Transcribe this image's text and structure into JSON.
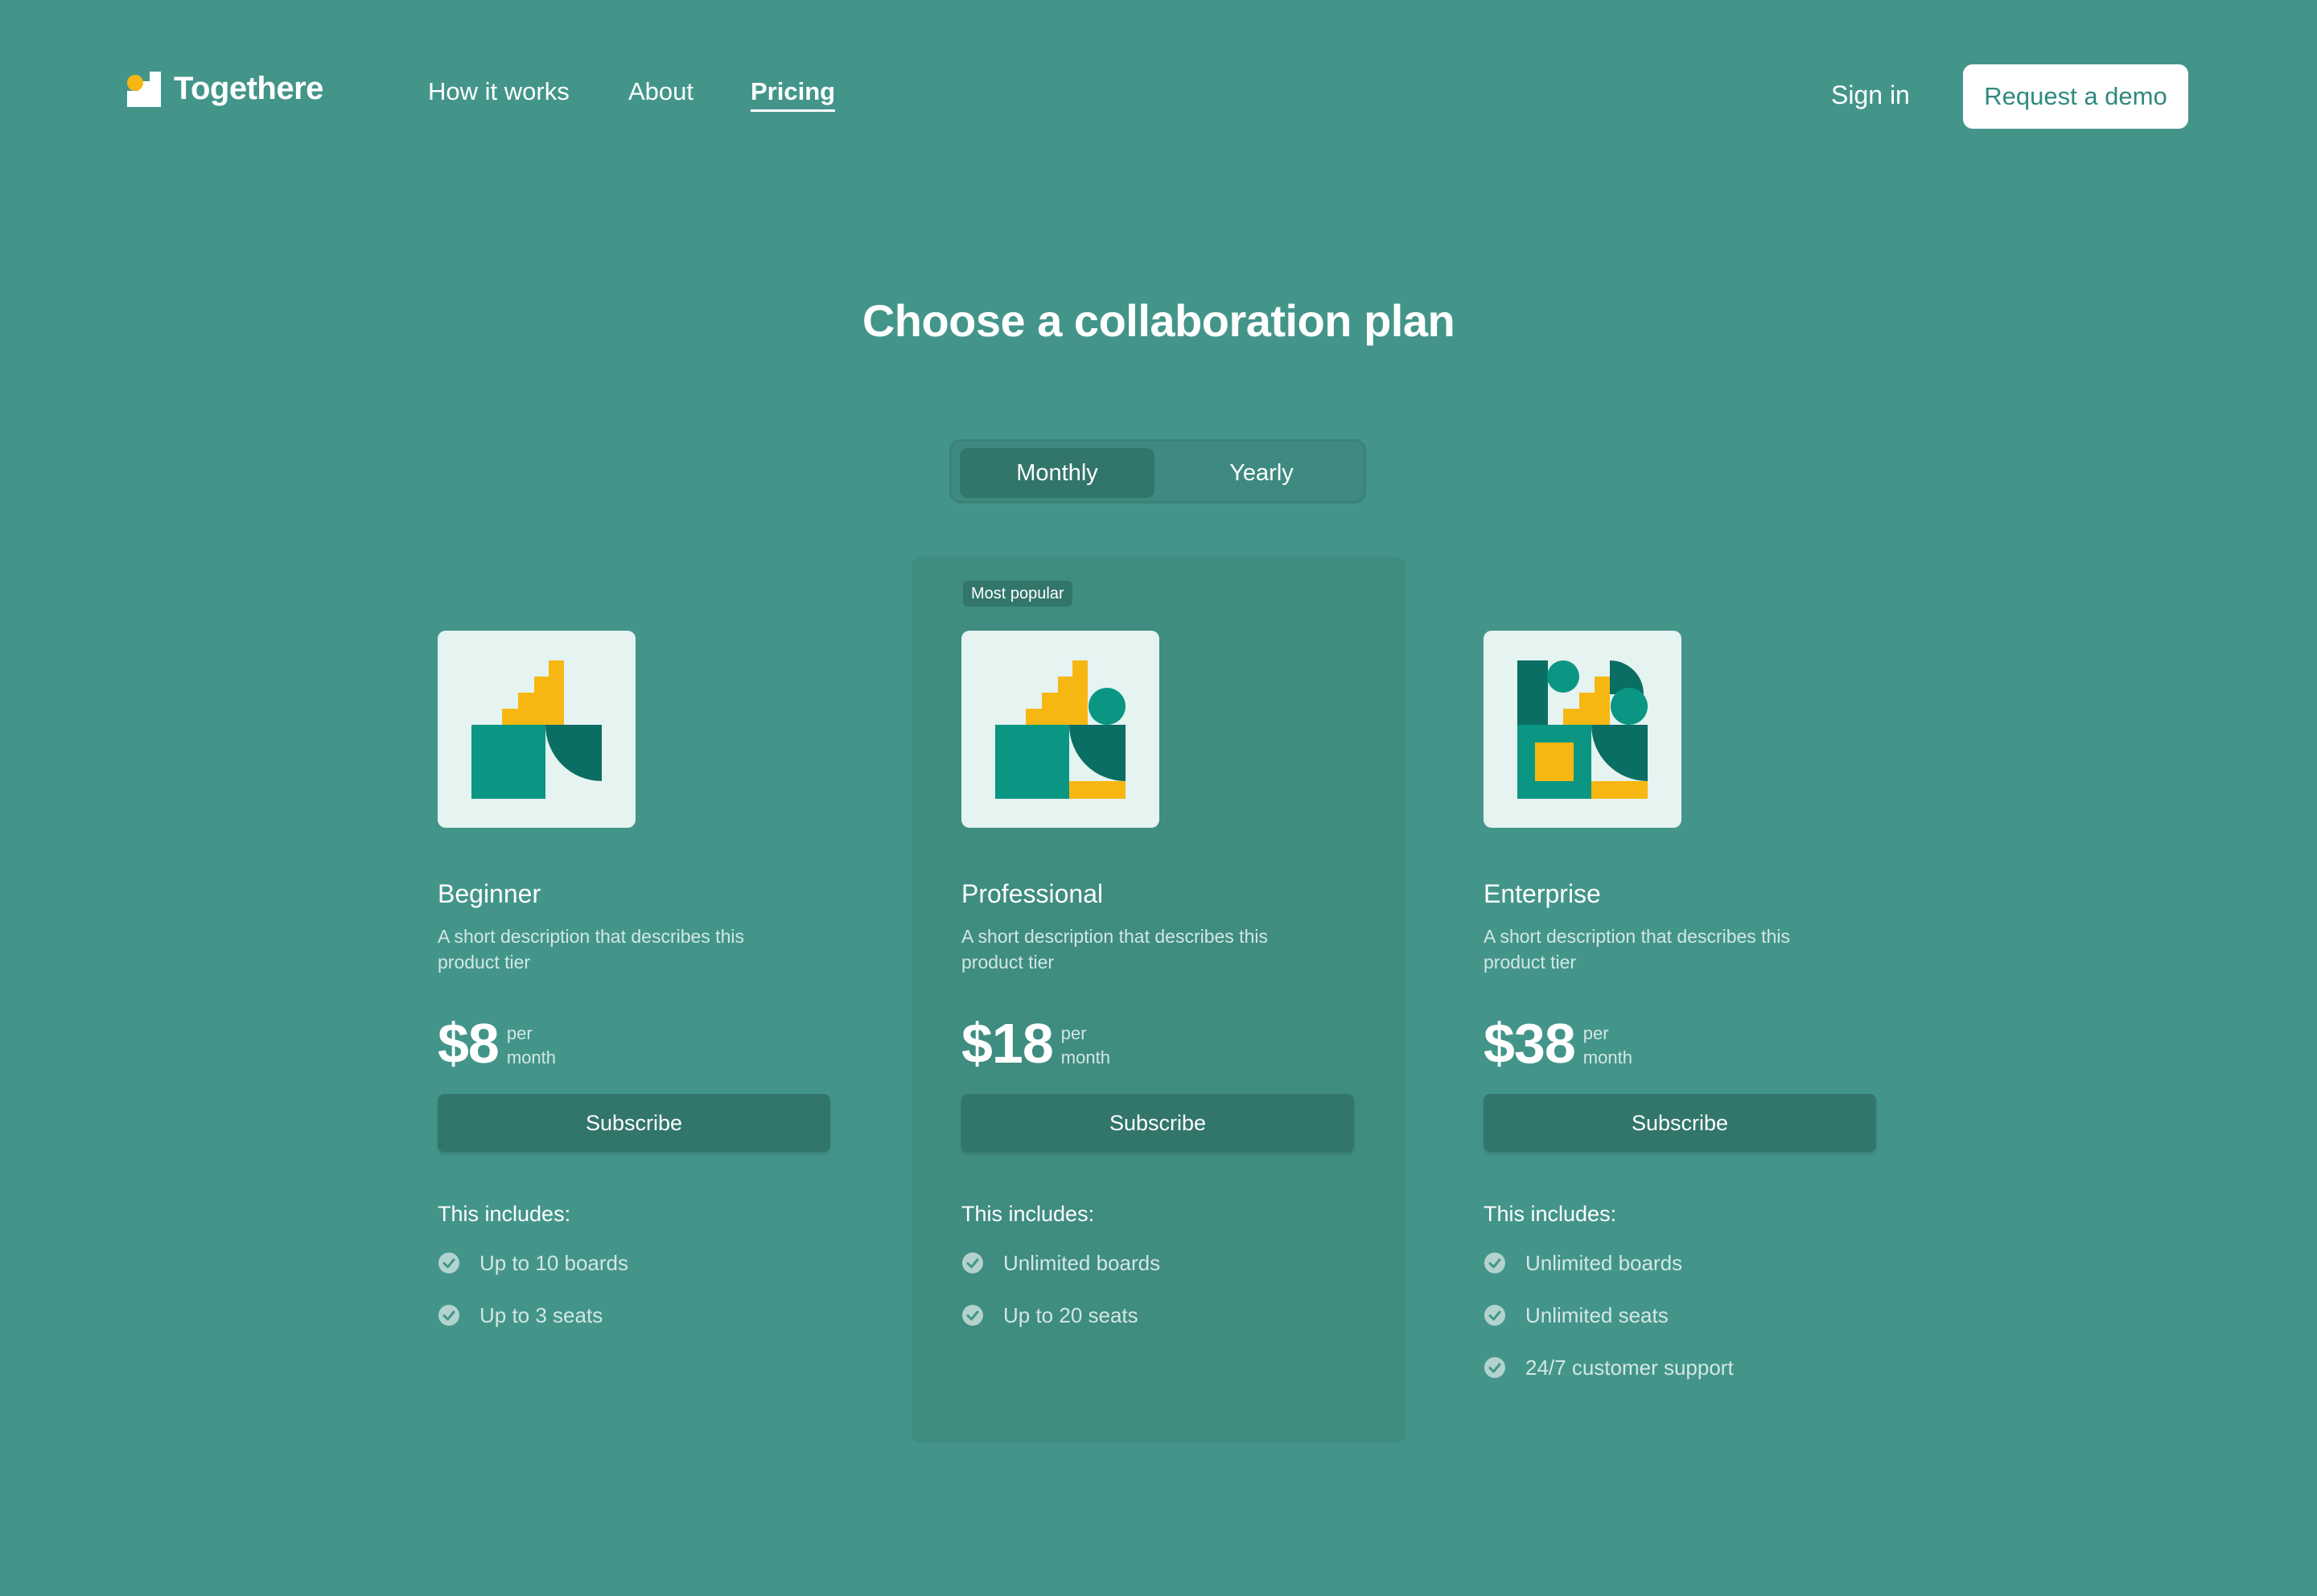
{
  "brand": {
    "name": "Togethere"
  },
  "nav": {
    "links": [
      {
        "label": "How it works"
      },
      {
        "label": "About"
      },
      {
        "label": "Pricing",
        "active": true
      }
    ],
    "sign_in": "Sign in",
    "demo": "Request a demo"
  },
  "heading": "Choose a collaboration plan",
  "billing": {
    "monthly": "Monthly",
    "yearly": "Yearly",
    "selected": "Monthly"
  },
  "badge": "Most popular",
  "colors": {
    "background": "#43958a",
    "yellow": "#f7b713",
    "teal": "#0b9683",
    "dark_teal": "#0b6e63",
    "card_bg": "#e5f3f1"
  },
  "plans": [
    {
      "name": "Beginner",
      "description": "A short description that describes this product tier",
      "price": "$8",
      "per": "per",
      "period": "month",
      "cta": "Subscribe",
      "includes_label": "This includes:",
      "features": [
        "Up to 10 boards",
        "Up to 3 seats"
      ]
    },
    {
      "name": "Professional",
      "description": "A short description that describes this product tier",
      "price": "$18",
      "per": "per",
      "period": "month",
      "cta": "Subscribe",
      "includes_label": "This includes:",
      "features": [
        "Unlimited boards",
        "Up to 20 seats"
      ]
    },
    {
      "name": "Enterprise",
      "description": "A short description that describes this product tier",
      "price": "$38",
      "per": "per",
      "period": "month",
      "cta": "Subscribe",
      "includes_label": "This includes:",
      "features": [
        "Unlimited boards",
        "Unlimited seats",
        "24/7 customer support"
      ]
    }
  ]
}
